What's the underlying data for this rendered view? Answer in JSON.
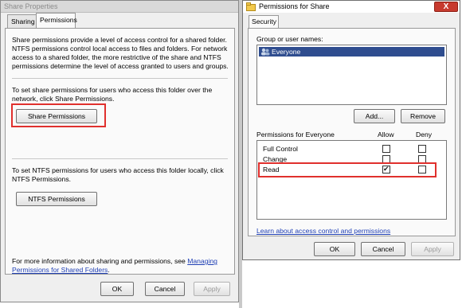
{
  "share_properties": {
    "title": "Share Properties",
    "tabs": [
      {
        "label": "Sharing",
        "active": false
      },
      {
        "label": "Permissions",
        "active": true
      }
    ],
    "description_lines": [
      "Share permissions provide a level of access control for a shared folder.",
      "NTFS permissions control local access to files and folders. For network",
      "access to a shared folder, the more restrictive of the share and NTFS",
      "permissions determine the level of access granted to users and groups."
    ],
    "share_section_lines": [
      "To set share permissions for users who access this folder over the",
      "network, click Share Permissions."
    ],
    "share_permissions_button": "Share Permissions",
    "ntfs_section_lines": [
      "To set NTFS permissions for users who access this folder locally, click",
      "NTFS Permissions."
    ],
    "ntfs_permissions_button": "NTFS Permissions",
    "more_info_prefix": "For more information about sharing and permissions, see ",
    "more_info_link_line1": "Managing",
    "more_info_link_line2": "Permissions for Shared Folders",
    "more_info_suffix": ".",
    "buttons": {
      "ok": "OK",
      "cancel": "Cancel",
      "apply": "Apply"
    }
  },
  "permissions_for_share": {
    "title": "Permissions for Share",
    "close": "X",
    "tab": "Security",
    "group_label": "Group or user names:",
    "users": [
      {
        "name": "Everyone",
        "selected": true
      }
    ],
    "add_button": "Add...",
    "remove_button": "Remove",
    "permissions_header": "Permissions for Everyone",
    "allow_header": "Allow",
    "deny_header": "Deny",
    "permissions": [
      {
        "name": "Full Control",
        "allow": false,
        "deny": false
      },
      {
        "name": "Change",
        "allow": false,
        "deny": false
      },
      {
        "name": "Read",
        "allow": true,
        "deny": false
      }
    ],
    "learn_link": "Learn about access control and permissions",
    "buttons": {
      "ok": "OK",
      "cancel": "Cancel",
      "apply": "Apply"
    }
  },
  "colors": {
    "highlight_box": "#e0302d",
    "link": "#1f3fb4",
    "selection": "#2f4d8f"
  }
}
